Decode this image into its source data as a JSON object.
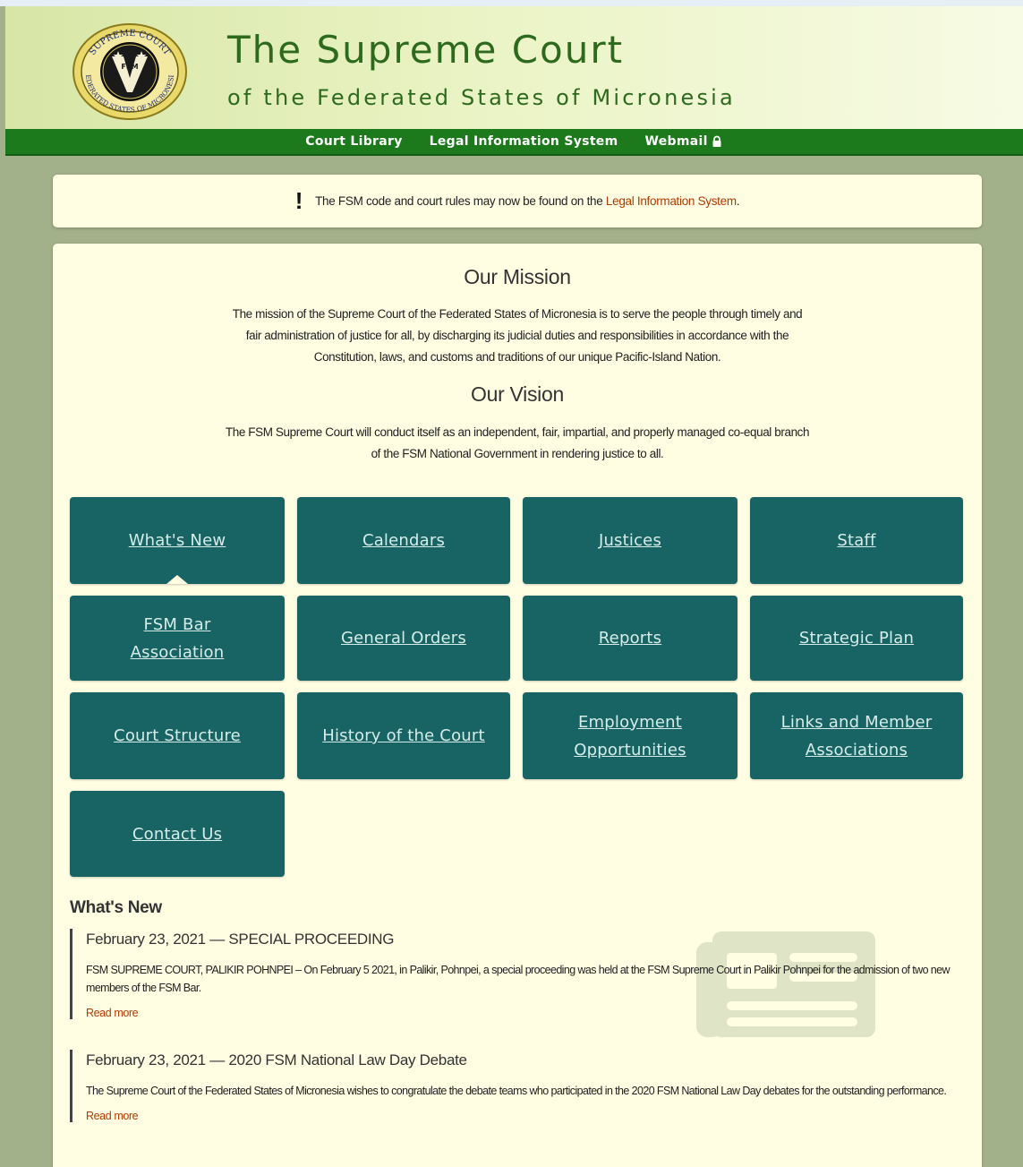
{
  "header": {
    "title": "The Supreme Court",
    "subtitle": "of the Federated States of Micronesia",
    "seal": {
      "text_top": "SUPREME COURT",
      "text_bottom": "FEDERATED STATES OF MICRONESIA",
      "center": "FSM"
    }
  },
  "nav": {
    "items": [
      {
        "label": "Court Library"
      },
      {
        "label": "Legal Information System"
      },
      {
        "label": "Webmail"
      }
    ]
  },
  "notice": {
    "text": "The FSM code and court rules may now be found on the ",
    "link": "Legal Information System",
    "suffix": "."
  },
  "mission": {
    "heading": "Our Mission",
    "lines": [
      "The mission of the Supreme Court of the Federated States of Micronesia is to serve the people through timely and",
      "fair administration of justice for all, by discharging its judicial duties and responsibilities in accordance with the",
      "Constitution, laws, and customs and traditions of our unique Pacific-Island Nation."
    ]
  },
  "vision": {
    "heading": "Our Vision",
    "lines": [
      "The FSM Supreme Court will conduct itself as an independent, fair, impartial, and properly managed co-equal branch",
      "of the FSM National Government in rendering justice to all."
    ]
  },
  "tiles": [
    {
      "line1": "What's New",
      "line2": ""
    },
    {
      "line1": "Calendars",
      "line2": ""
    },
    {
      "line1": "Justices",
      "line2": ""
    },
    {
      "line1": "Staff",
      "line2": ""
    },
    {
      "line1": "FSM Bar",
      "line2": "Association"
    },
    {
      "line1": "General Orders",
      "line2": ""
    },
    {
      "line1": "Reports",
      "line2": ""
    },
    {
      "line1": "Strategic Plan",
      "line2": ""
    },
    {
      "line1": "Court Structure",
      "line2": ""
    },
    {
      "line1": "History of the Court",
      "line2": ""
    },
    {
      "line1": "Employment",
      "line2": "Opportunities"
    },
    {
      "line1": "Links and Member",
      "line2": "Associations"
    },
    {
      "line1": "Contact Us",
      "line2": ""
    }
  ],
  "news": {
    "heading": "What's New",
    "items": [
      {
        "title": "February 23, 2021 — SPECIAL PROCEEDING",
        "body": "FSM SUPREME COURT, PALIKIR POHNPEI – On February 5 2021, in Palikir, Pohnpei, a special proceeding was held at the FSM Supreme Court in Palikir Pohnpei for the admission of two new members of the FSM Bar.",
        "link": "Read more"
      },
      {
        "title": "February 23, 2021 — 2020 FSM National Law Day Debate",
        "body": "The Supreme Court of the Federated States of Micronesia wishes to congratulate the debate teams who participated in the 2020 FSM National Law Day debates for the outstanding performance.",
        "link": "Read more"
      }
    ]
  },
  "colors": {
    "page_bg": "#a3b18a",
    "nav_bg": "#1c7a1c",
    "tile_bg": "#186464",
    "panel_bg": "#fffde2",
    "link": "#b23b00",
    "title": "#2e6a1e"
  }
}
